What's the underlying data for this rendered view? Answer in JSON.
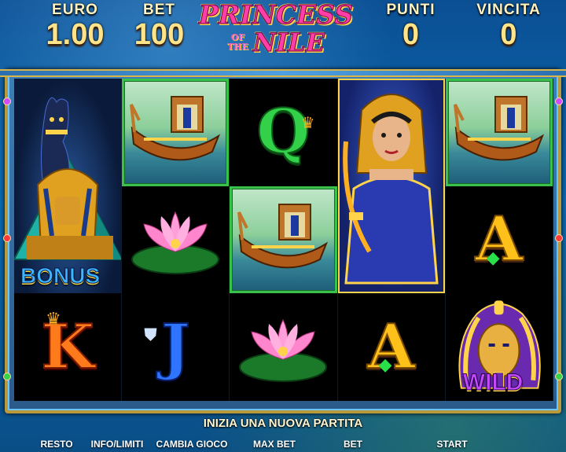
{
  "header": {
    "euro": {
      "label": "EURO",
      "value": "1.00"
    },
    "bet": {
      "label": "BET",
      "value": "100"
    },
    "punti": {
      "label": "PUNTI",
      "value": "0"
    },
    "vincita": {
      "label": "VINCITA",
      "value": "0"
    }
  },
  "logo": {
    "line1": "PRINCESS",
    "of": "OF",
    "the": "THE",
    "line2": "NILE"
  },
  "reels": [
    [
      {
        "symbol": "cat-sphinx-pyramid",
        "label": "BONUS"
      },
      {
        "symbol": "boat",
        "win": true
      },
      {
        "symbol": "letter",
        "text": "Q"
      },
      {
        "symbol": "cleopatra"
      },
      {
        "symbol": "boat",
        "win": true
      }
    ],
    [
      {
        "symbol": "cat-sphinx-pyramid"
      },
      {
        "symbol": "lotus"
      },
      {
        "symbol": "boat",
        "win": true
      },
      {
        "symbol": "cleopatra"
      },
      {
        "symbol": "letter",
        "text": "A"
      }
    ],
    [
      {
        "symbol": "letter",
        "text": "K"
      },
      {
        "symbol": "letter",
        "text": "J"
      },
      {
        "symbol": "lotus"
      },
      {
        "symbol": "letter",
        "text": "A"
      },
      {
        "symbol": "pharaoh-mask",
        "label": "WILD"
      }
    ]
  ],
  "message": "INIZIA UNA NUOVA PARTITA",
  "controls": [
    "RESTO",
    "INFO/LIMITI",
    "CAMBIA GIOCO",
    "MAX BET",
    "BET",
    "START"
  ],
  "colors": {
    "win_border": "#39c24a",
    "title_pink": "#ff3ea8",
    "gold": "#ffe48a"
  }
}
